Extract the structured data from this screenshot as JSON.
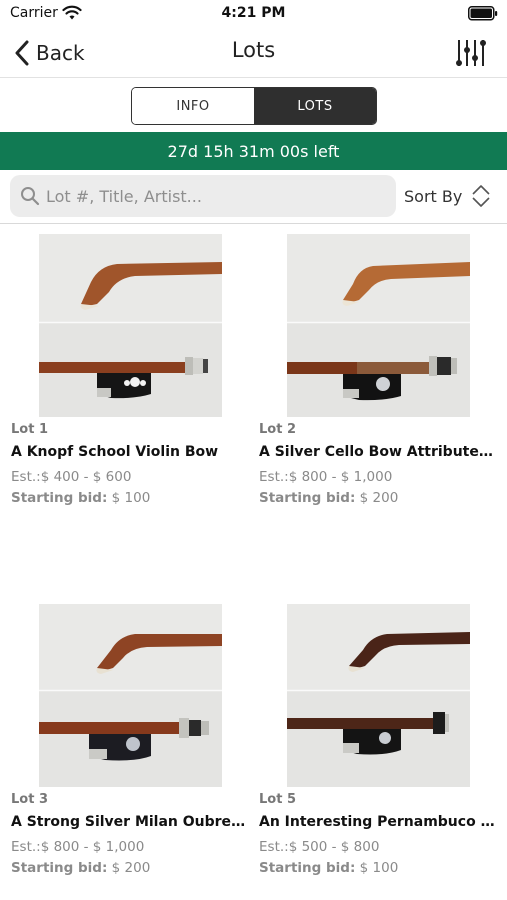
{
  "status_bar": {
    "carrier": "Carrier",
    "time": "4:21 PM"
  },
  "nav": {
    "back_label": "Back",
    "title": "Lots"
  },
  "tabs": [
    {
      "label": "INFO",
      "active": false
    },
    {
      "label": "LOTS",
      "active": true
    }
  ],
  "countdown": {
    "text": "27d 15h 31m 00s left",
    "color": "#117a53"
  },
  "search": {
    "placeholder": "Lot #, Title, Artist...",
    "value": ""
  },
  "sort": {
    "label": "Sort By"
  },
  "lots": [
    {
      "lot_number": "Lot 1",
      "title": "A Knopf School Violin Bow",
      "estimate": "Est.:$ 400 - $ 600",
      "starting_bid_label": "Starting bid:",
      "starting_bid_value": " $ 100"
    },
    {
      "lot_number": "Lot 2",
      "title": "A Silver Cello Bow Attributed...",
      "estimate": "Est.:$ 800 - $ 1,000",
      "starting_bid_label": "Starting bid:",
      "starting_bid_value": " $ 200"
    },
    {
      "lot_number": "Lot 3",
      "title": "A Strong Silver Milan Oubrec...",
      "estimate": "Est.:$ 800 - $ 1,000",
      "starting_bid_label": "Starting bid:",
      "starting_bid_value": " $ 200"
    },
    {
      "lot_number": "Lot 5",
      "title": "An Interesting Pernambuco V...",
      "estimate": "Est.:$ 500 - $ 800",
      "starting_bid_label": "Starting bid:",
      "starting_bid_value": " $ 100"
    }
  ],
  "icons": {
    "back": "chevron-left-icon",
    "filter": "sliders-icon",
    "search": "search-icon",
    "sort": "sort-updown-icon",
    "wifi": "wifi-icon",
    "battery": "battery-icon"
  }
}
